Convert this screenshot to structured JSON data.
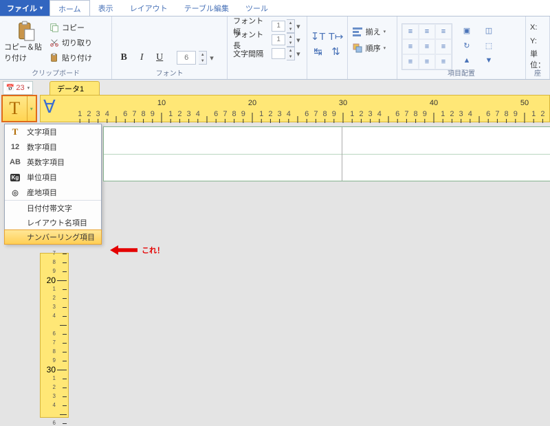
{
  "tabs": {
    "file": "ファイル",
    "home": "ホーム",
    "view": "表示",
    "layout": "レイアウト",
    "table": "テーブル編集",
    "tool": "ツール"
  },
  "ribbon": {
    "clipboard": {
      "paste": "コピー＆貼り付け",
      "copy": "コピー",
      "cut": "切り取り",
      "paste2": "貼り付け",
      "label": "クリップボード"
    },
    "font": {
      "label": "フォント",
      "size": "6",
      "bold": "B",
      "italic": "I",
      "underline": "U",
      "width_l": "フォント幅",
      "height_l": "フォント長",
      "spacing_l": "文字間隔",
      "val1": "1"
    },
    "arrange": {
      "align": "揃え",
      "order": "順序"
    },
    "itemalign": {
      "label": "項目配置"
    },
    "coord": {
      "x": "X:",
      "y": "Y:",
      "unit": "単位：",
      "block": "座"
    }
  },
  "doc": {
    "date": "23",
    "tab1": "データ1"
  },
  "ruler": {
    "majors": [
      10,
      20,
      30,
      40,
      50
    ],
    "left_majors": [
      20,
      30
    ]
  },
  "tool_dropdown": {
    "items": [
      {
        "icon": "T",
        "label": "文字項目"
      },
      {
        "icon": "12",
        "label": "数字項目"
      },
      {
        "icon": "AB",
        "label": "英数字項目"
      },
      {
        "icon": "Kg",
        "label": "単位項目"
      },
      {
        "icon": "◎",
        "label": "産地項目"
      },
      {
        "icon": "",
        "label": "日付付帯文字",
        "sep": true
      },
      {
        "icon": "",
        "label": "レイアウト名項目"
      },
      {
        "icon": "",
        "label": "ナンバーリング項目",
        "highlight": true,
        "sep": true
      }
    ]
  },
  "annotation": "これ！"
}
